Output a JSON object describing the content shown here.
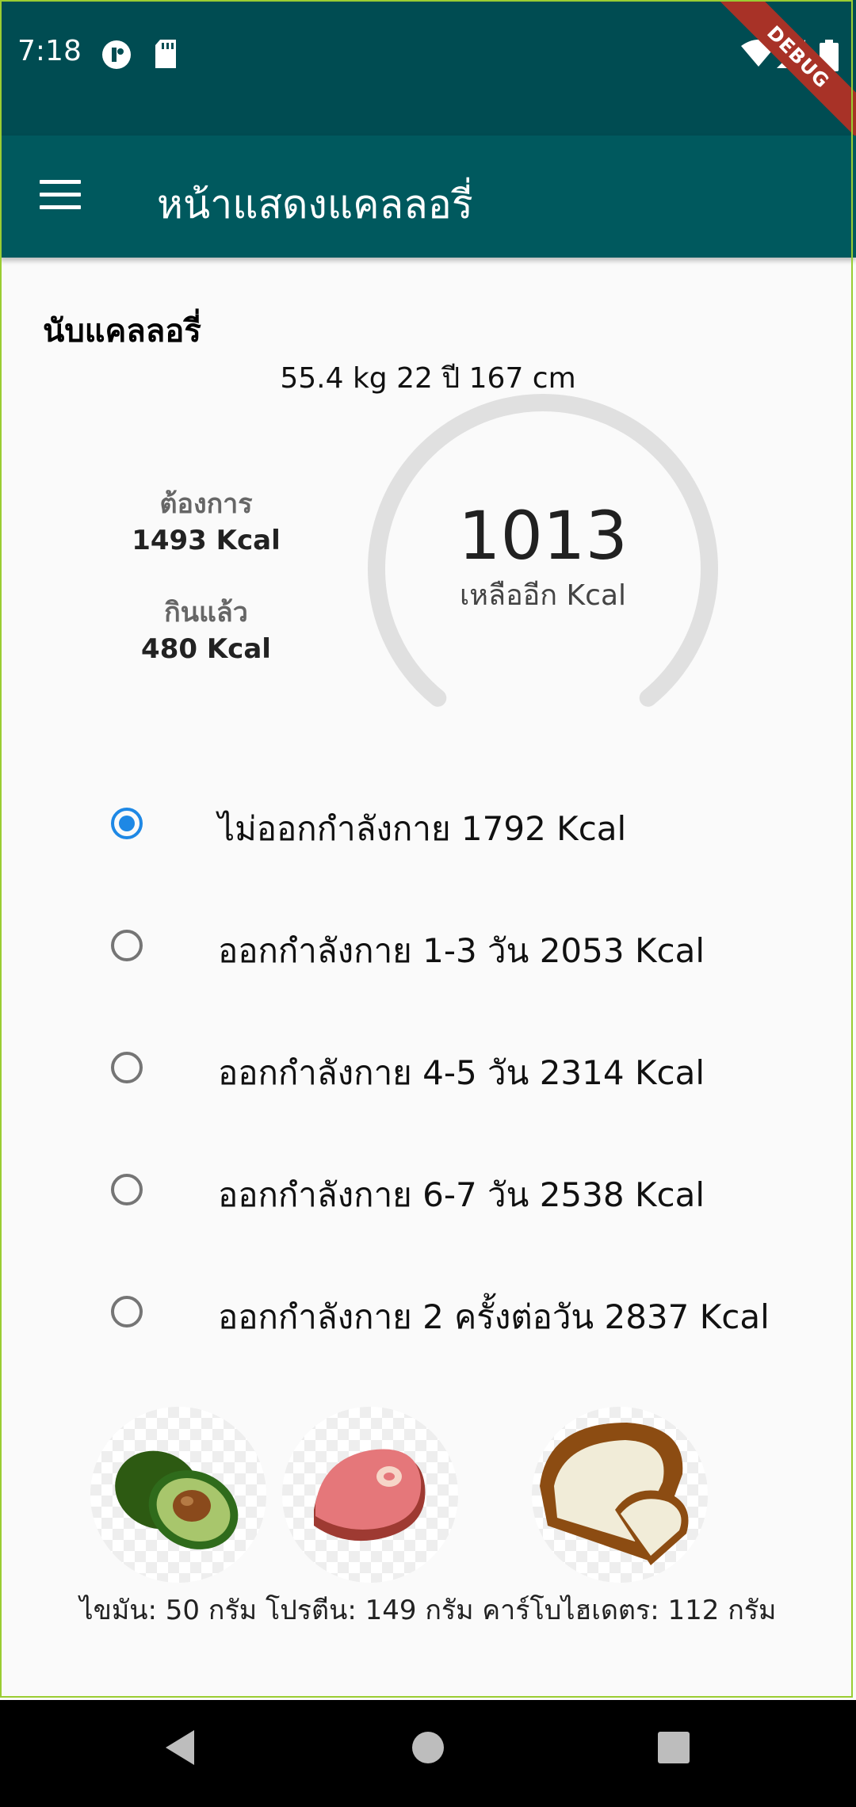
{
  "status_bar": {
    "time": "7:18",
    "debug_label": "DEBUG"
  },
  "app_bar": {
    "title": "หน้าแสดงแคลลอรี่"
  },
  "calorie_section": {
    "title": "นับแคลลอรี่",
    "body_stats": "55.4 kg 22 ปี  167 cm",
    "target_label": "ต้องการ",
    "target_value": "1493 Kcal",
    "eaten_label": "กินแล้ว",
    "eaten_value": "480 Kcal",
    "remaining_value": "1013",
    "remaining_label": "เหลืออีก Kcal"
  },
  "activity_options": [
    {
      "label": "ไม่ออกกำลังกาย 1792 Kcal",
      "selected": true
    },
    {
      "label": "ออกกำลังกาย 1-3 วัน 2053 Kcal",
      "selected": false
    },
    {
      "label": "ออกกำลังกาย 4-5 วัน 2314 Kcal",
      "selected": false
    },
    {
      "label": "ออกกำลังกาย 6-7 วัน 2538 Kcal",
      "selected": false
    },
    {
      "label": "ออกกำลังกาย 2 ครั้งต่อวัน 2837 Kcal",
      "selected": false
    }
  ],
  "macros": {
    "fat": "ไขมัน: 50 กรัม",
    "protein": "โปรตีน: 149 กรัม",
    "carbs": "คาร์โบไฮเดตร: 112 กรัม"
  },
  "icons": [
    "menu-icon",
    "wifi-icon",
    "signal-icon",
    "battery-icon",
    "sd-card-icon",
    "avocado-icon",
    "steak-icon",
    "bread-icon",
    "back-icon",
    "home-icon",
    "recents-icon"
  ],
  "colors": {
    "status_bar": "#004c52",
    "app_bar": "#00595e",
    "radio_selected": "#1e88e5",
    "gauge_track": "#e0e0e0"
  }
}
